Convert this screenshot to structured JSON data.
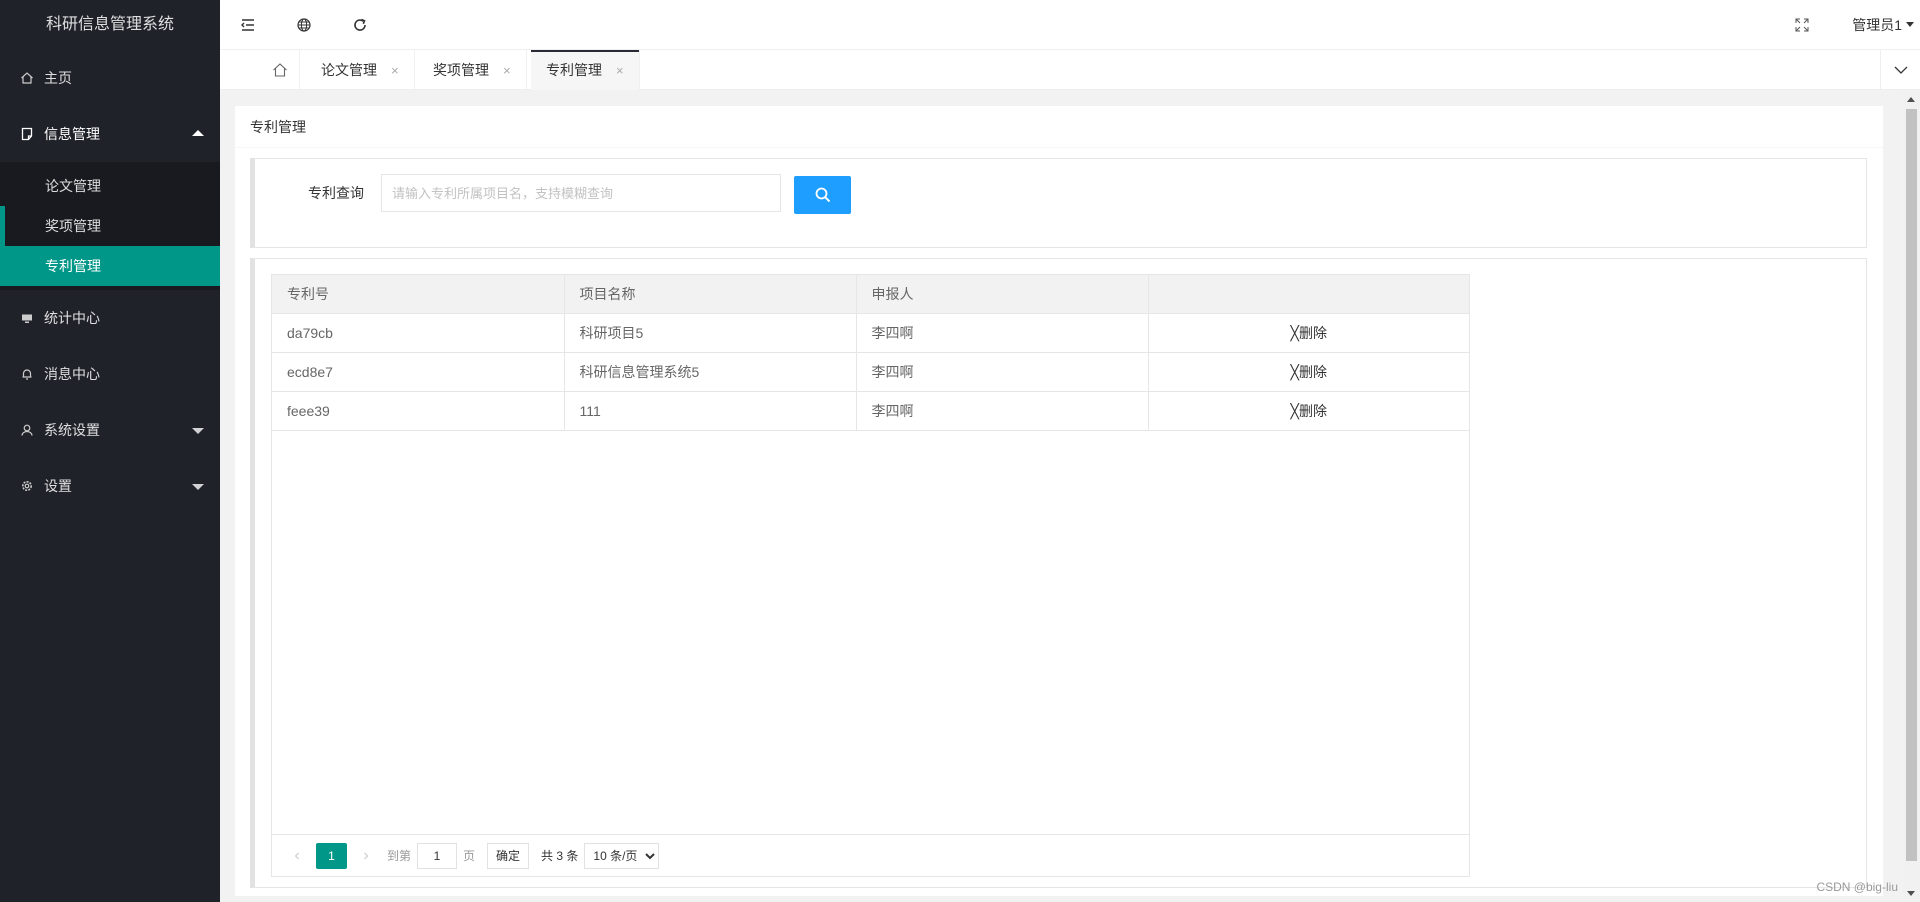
{
  "app": {
    "title": "科研信息管理系统"
  },
  "sidebar": {
    "items": [
      {
        "label": "主页",
        "icon": "home-icon"
      },
      {
        "label": "信息管理",
        "icon": "document-icon",
        "expanded": true,
        "children": [
          {
            "label": "论文管理"
          },
          {
            "label": "奖项管理"
          },
          {
            "label": "专利管理",
            "active": true
          }
        ]
      },
      {
        "label": "统计中心",
        "icon": "monitor-icon"
      },
      {
        "label": "消息中心",
        "icon": "bell-icon"
      },
      {
        "label": "系统设置",
        "icon": "user-icon"
      },
      {
        "label": "设置",
        "icon": "gear-icon"
      }
    ]
  },
  "header": {
    "user": "管理员1"
  },
  "tabs": [
    {
      "label": "论文管理",
      "close": "×"
    },
    {
      "label": "奖项管理",
      "close": "×"
    },
    {
      "label": "专利管理",
      "close": "×",
      "active": true
    }
  ],
  "page": {
    "title": "专利管理"
  },
  "search": {
    "label": "专利查询",
    "placeholder": "请输入专利所属项目名，支持模糊查询",
    "value": ""
  },
  "table": {
    "columns": [
      "专利号",
      "项目名称",
      "申报人",
      ""
    ],
    "delete_label": "╳删除",
    "rows": [
      [
        "da79cb",
        "科研项目5",
        "李四啊"
      ],
      [
        "ecd8e7",
        "科研信息管理系统5",
        "李四啊"
      ],
      [
        "feee39",
        "111",
        "李四啊"
      ]
    ]
  },
  "pager": {
    "current": "1",
    "goto_prefix": "到第",
    "goto_value": "1",
    "goto_suffix": "页",
    "confirm": "确定",
    "total": "共 3 条",
    "page_size": "10 条/页"
  },
  "watermark": "CSDN @big-liu",
  "colors": {
    "sidebar_bg": "#20222a",
    "accent": "#009688",
    "search_btn": "#1e9fff"
  }
}
